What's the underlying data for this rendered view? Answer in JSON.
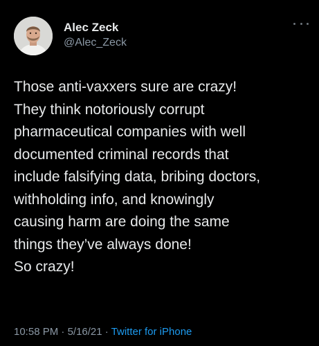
{
  "author": {
    "name": "Alec Zeck",
    "handle": "@Alec_Zeck"
  },
  "menu": {
    "icon": "more-dots-icon"
  },
  "tweet": {
    "lines": [
      "Those anti-vaxxers sure are crazy!",
      "They think notoriously corrupt",
      "pharmaceutical companies with well",
      "documented criminal records that",
      "include falsifying data, bribing doctors,",
      "withholding info, and knowingly",
      "causing harm are doing the same",
      "things they’ve always done!",
      "So crazy!"
    ]
  },
  "meta": {
    "time": "10:58 PM",
    "separator": " · ",
    "date": "5/16/21",
    "source": "Twitter for iPhone"
  },
  "colors": {
    "background": "#000000",
    "text": "#e7e9ea",
    "secondary": "#8b98a5",
    "link": "#1d9bf0"
  }
}
